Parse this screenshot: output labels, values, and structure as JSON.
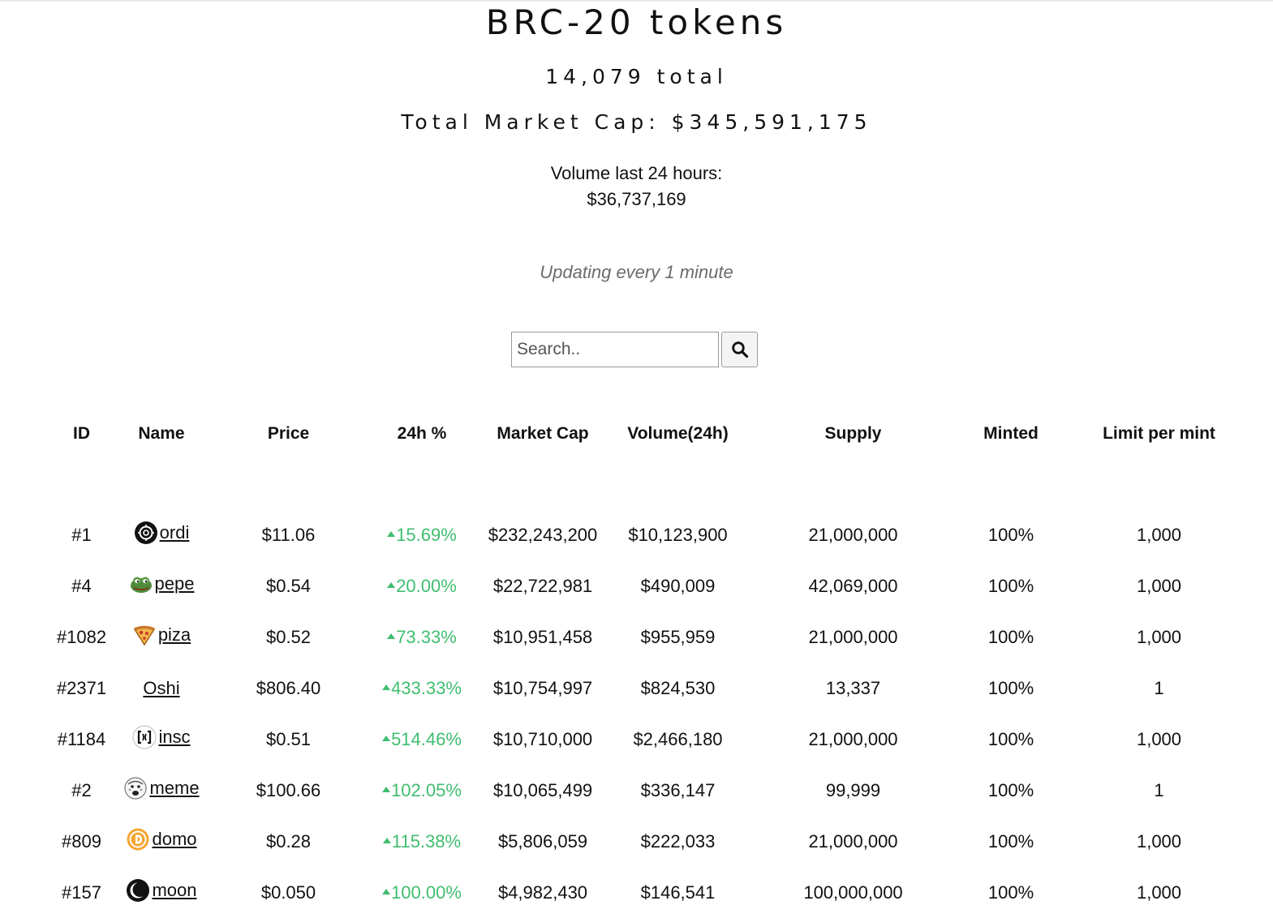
{
  "header": {
    "title": "BRC-20 tokens",
    "total": "14,079 total",
    "market_cap": "Total Market Cap: $345,591,175",
    "volume_label": "Volume last 24 hours:",
    "volume_value": "$36,737,169",
    "updating": "Updating every 1 minute"
  },
  "search": {
    "placeholder": "Search..",
    "value": "",
    "button_icon": "search-icon"
  },
  "table": {
    "columns": [
      "ID",
      "Name",
      "Price",
      "24h %",
      "Market Cap",
      "Volume(24h)",
      "Supply",
      "Minted",
      "Limit per mint"
    ],
    "rows": [
      {
        "id": "#1",
        "name": "ordi",
        "icon": "ordi-logo-icon",
        "price": "$11.06",
        "change": "15.69%",
        "market_cap": "$232,243,200",
        "volume": "$10,123,900",
        "supply": "21,000,000",
        "minted": "100%",
        "limit": "1,000"
      },
      {
        "id": "#4",
        "name": "pepe",
        "icon": "pepe-frog-icon",
        "price": "$0.54",
        "change": "20.00%",
        "market_cap": "$22,722,981",
        "volume": "$490,009",
        "supply": "42,069,000",
        "minted": "100%",
        "limit": "1,000"
      },
      {
        "id": "#1082",
        "name": "piza",
        "icon": "pizza-slice-icon",
        "price": "$0.52",
        "change": "73.33%",
        "market_cap": "$10,951,458",
        "volume": "$955,959",
        "supply": "21,000,000",
        "minted": "100%",
        "limit": "1,000"
      },
      {
        "id": "#2371",
        "name": "Oshi",
        "icon": "",
        "price": "$806.40",
        "change": "433.33%",
        "market_cap": "$10,754,997",
        "volume": "$824,530",
        "supply": "13,337",
        "minted": "100%",
        "limit": "1"
      },
      {
        "id": "#1184",
        "name": "insc",
        "icon": "insc-brackets-icon",
        "price": "$0.51",
        "change": "514.46%",
        "market_cap": "$10,710,000",
        "volume": "$2,466,180",
        "supply": "21,000,000",
        "minted": "100%",
        "limit": "1,000"
      },
      {
        "id": "#2",
        "name": "meme",
        "icon": "meme-face-icon",
        "price": "$100.66",
        "change": "102.05%",
        "market_cap": "$10,065,499",
        "volume": "$336,147",
        "supply": "99,999",
        "minted": "100%",
        "limit": "1"
      },
      {
        "id": "#809",
        "name": "domo",
        "icon": "domo-coin-icon",
        "price": "$0.28",
        "change": "115.38%",
        "market_cap": "$5,806,059",
        "volume": "$222,033",
        "supply": "21,000,000",
        "minted": "100%",
        "limit": "1,000"
      },
      {
        "id": "#157",
        "name": "moon",
        "icon": "moon-eclipse-icon",
        "price": "$0.050",
        "change": "100.00%",
        "market_cap": "$4,982,430",
        "volume": "$146,541",
        "supply": "100,000,000",
        "minted": "100%",
        "limit": "1,000"
      }
    ]
  },
  "colors": {
    "positive": "#3fbe6f",
    "muted": "#6b6b6b",
    "text": "#111111"
  }
}
